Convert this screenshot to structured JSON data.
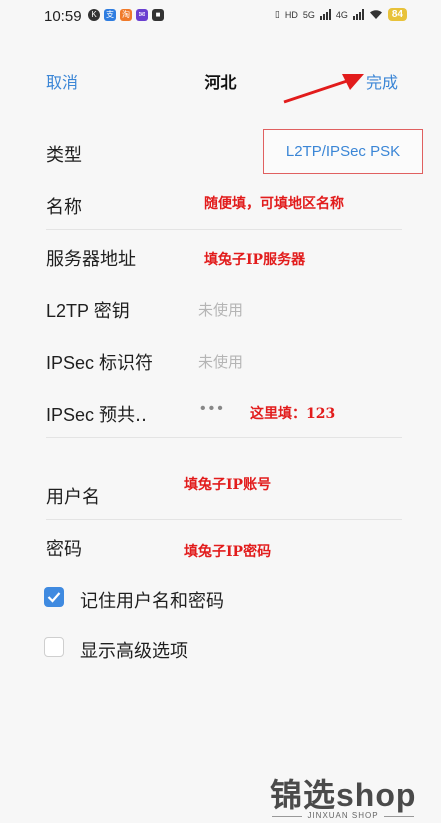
{
  "status_bar": {
    "time": "10:59",
    "network_labels": [
      "HD",
      "5G",
      "4G"
    ],
    "battery": "84"
  },
  "header": {
    "cancel_label": "取消",
    "title": "河北",
    "done_label": "完成"
  },
  "fields": {
    "type_label": "类型",
    "type_value": "L2TP/IPSec PSK",
    "name_label": "名称",
    "server_label": "服务器地址",
    "l2tp_secret_label": "L2TP 密钥",
    "l2tp_secret_value": "未使用",
    "ipsec_id_label": "IPSec 标识符",
    "ipsec_id_value": "未使用",
    "ipsec_psk_label": "IPSec 预共‥",
    "ipsec_psk_value": "•••",
    "username_label": "用户名",
    "password_label": "密码"
  },
  "options": {
    "remember_label": "记住用户名和密码",
    "remember_checked": true,
    "advanced_label": "显示高级选项",
    "advanced_checked": false
  },
  "annotations": {
    "name_note": "随便填，可填地区名称",
    "server_note": "填兔子IP服务器",
    "psk_note": "这里填：123",
    "username_note": "填兔子IP账号",
    "password_note": "填兔子IP密码",
    "arrow_color": "#e21c1c"
  },
  "watermark": {
    "main": "锦选shop",
    "sub": "JINXUAN SHOP"
  },
  "colors": {
    "accent": "#3b86d6",
    "note": "#e21c1c",
    "checkbox": "#3f8ae0"
  }
}
